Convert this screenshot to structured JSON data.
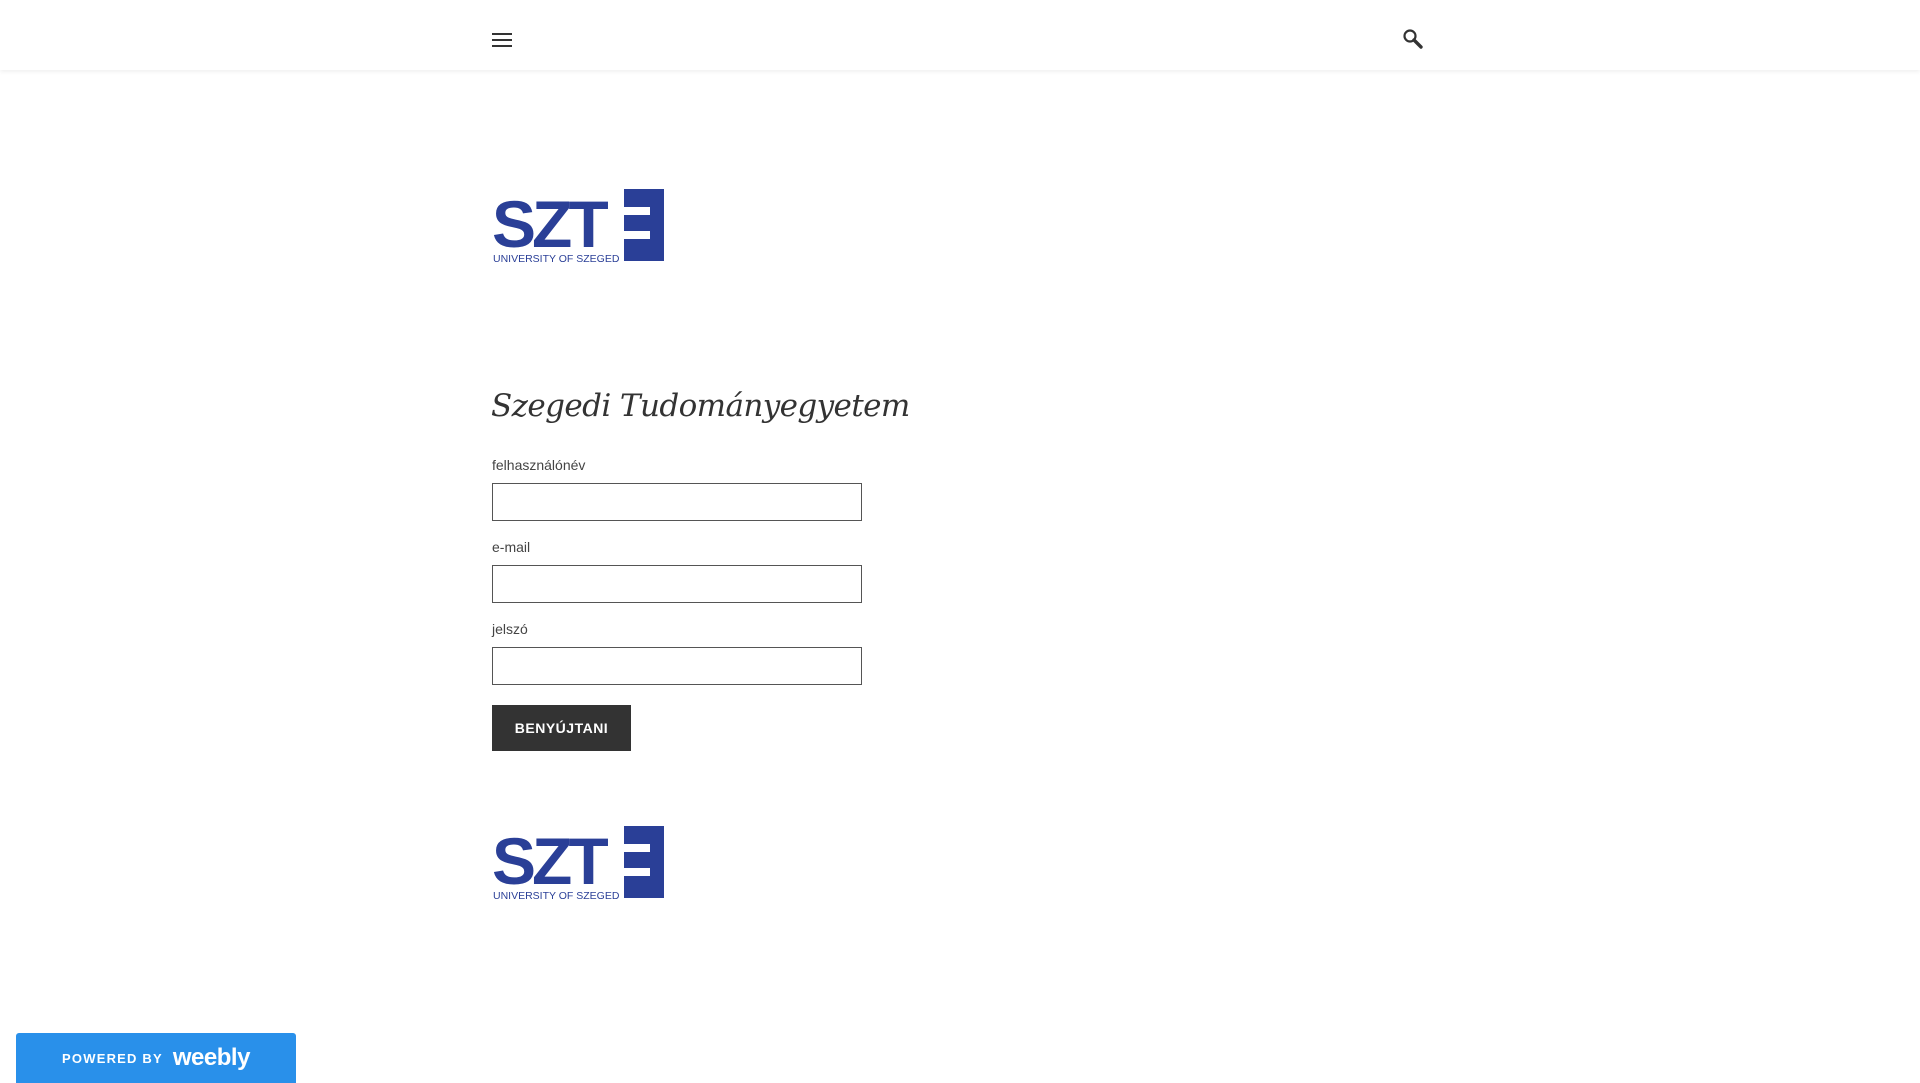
{
  "header": {
    "menu_icon": "hamburger-menu-icon",
    "search_icon": "magnifier-search-icon"
  },
  "logo": {
    "letters": "SZTE",
    "subtitle": "UNIVERSITY OF SZEGED",
    "color": "#2a3f97"
  },
  "form": {
    "title": "Szegedi Tudományegyetem",
    "fields": [
      {
        "label": "felhasználónév",
        "value": ""
      },
      {
        "label": "e-mail",
        "value": ""
      },
      {
        "label": "jelszó",
        "value": ""
      }
    ],
    "submit_label": "BENYÚJTANI"
  },
  "footer_badge": {
    "powered_text": "POWERED BY",
    "brand": "weebly",
    "color": "#2990ea"
  }
}
